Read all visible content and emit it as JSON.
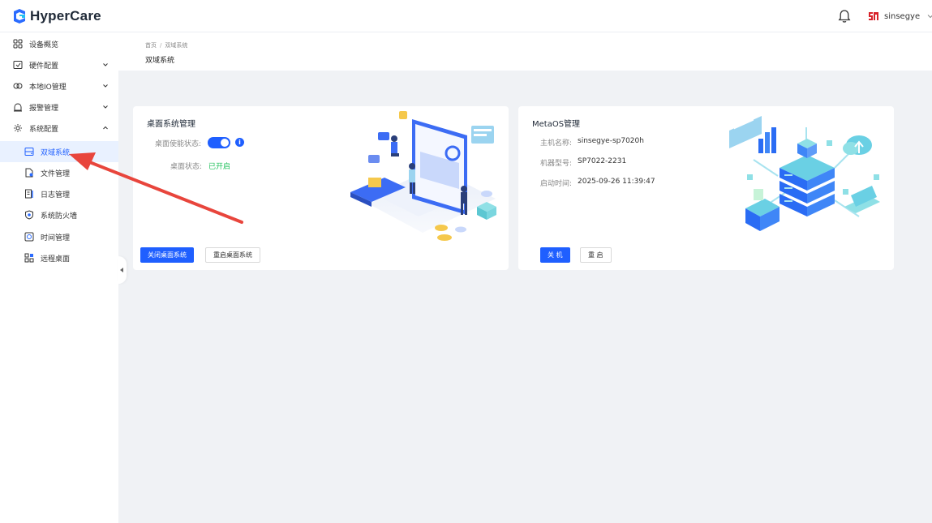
{
  "app": {
    "name": "HyperCare"
  },
  "header": {
    "user_name": "sinsegye"
  },
  "sidebar": {
    "items": [
      {
        "label": "设备概览"
      },
      {
        "label": "硬件配置"
      },
      {
        "label": "本地IO管理"
      },
      {
        "label": "报警管理"
      },
      {
        "label": "系统配置"
      },
      {
        "label": "双域系统"
      },
      {
        "label": "文件管理"
      },
      {
        "label": "日志管理"
      },
      {
        "label": "系统防火墙"
      },
      {
        "label": "时间管理"
      },
      {
        "label": "远程桌面"
      }
    ]
  },
  "breadcrumb": {
    "home": "首页",
    "separator": "/",
    "current": "双域系统"
  },
  "page": {
    "title": "双域系统"
  },
  "desktop_card": {
    "title": "桌面系统管理",
    "enable_label": "桌面使能状态:",
    "info_icon": "i",
    "status_label": "桌面状态:",
    "status_value": "已开启",
    "btn_close": "关闭桌面系统",
    "btn_restart": "重启桌面系统"
  },
  "metaos_card": {
    "title": "MetaOS管理",
    "host_label": "主机名称:",
    "host_value": "sinsegye-sp7020h",
    "model_label": "机器型号:",
    "model_value": "SP7022-2231",
    "boot_label": "启动时间:",
    "boot_value": "2025-09-26 11:39:47",
    "btn_shutdown": "关 机",
    "btn_restart": "重 启"
  },
  "colors": {
    "accent": "#1f5fff",
    "status_on": "#20c05c",
    "annotation": "#e8453c"
  }
}
